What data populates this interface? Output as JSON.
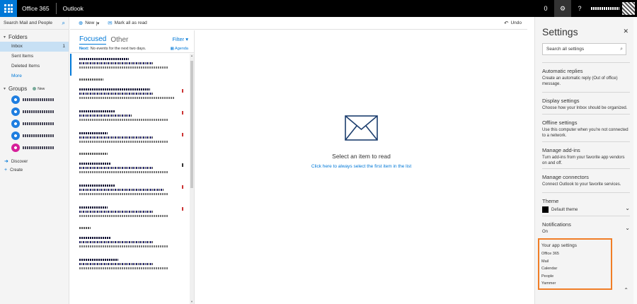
{
  "topbar": {
    "brand": "Office 365",
    "app": "Outlook",
    "notification_count": "0",
    "settings_glyph": "⚙",
    "help_glyph": "?"
  },
  "left": {
    "search_placeholder": "Search Mail and People",
    "folders_heading": "Folders",
    "folders": [
      {
        "label": "Inbox",
        "count": "1"
      },
      {
        "label": "Sent Items",
        "count": ""
      },
      {
        "label": "Deleted Items",
        "count": ""
      }
    ],
    "more": "More",
    "groups_heading": "Groups",
    "groups_new": "New",
    "group_colors": [
      "#1f7ee0",
      "#1f7ee0",
      "#1f7ee0",
      "#1f7ee0",
      "#d6209a"
    ],
    "discover": "Discover",
    "create": "Create"
  },
  "commands": {
    "new": "New",
    "mark_all_read": "Mark all as read",
    "undo": "Undo"
  },
  "list": {
    "tab_focused": "Focused",
    "tab_other": "Other",
    "filter": "Filter",
    "next_label": "Next:",
    "next_text": "No events for the next two days.",
    "agenda": "Agenda"
  },
  "reading": {
    "title": "Select an item to read",
    "link": "Click here to always select the first item in the list"
  },
  "settings": {
    "title": "Settings",
    "search_placeholder": "Search all settings",
    "blocks": [
      {
        "h": "Automatic replies",
        "d": "Create an automatic reply (Out of office) message."
      },
      {
        "h": "Display settings",
        "d": "Choose how your Inbox should be organized."
      },
      {
        "h": "Offline settings",
        "d": "Use this computer when you're not connected to a network."
      },
      {
        "h": "Manage add-ins",
        "d": "Turn add-ins from your favorite app vendors on and off."
      },
      {
        "h": "Manage connectors",
        "d": "Connect Outlook to your favorite services."
      }
    ],
    "theme_heading": "Theme",
    "theme_value": "Default theme",
    "notifications_heading": "Notifications",
    "notifications_value": "On",
    "app_settings_heading": "Your app settings",
    "app_settings": [
      "Office 365",
      "Mail",
      "Calendar",
      "People",
      "Yammer"
    ]
  },
  "colors": {
    "accent": "#0078d7",
    "highlight_box": "#f07d26",
    "selected_folder": "#c7e0f4"
  }
}
